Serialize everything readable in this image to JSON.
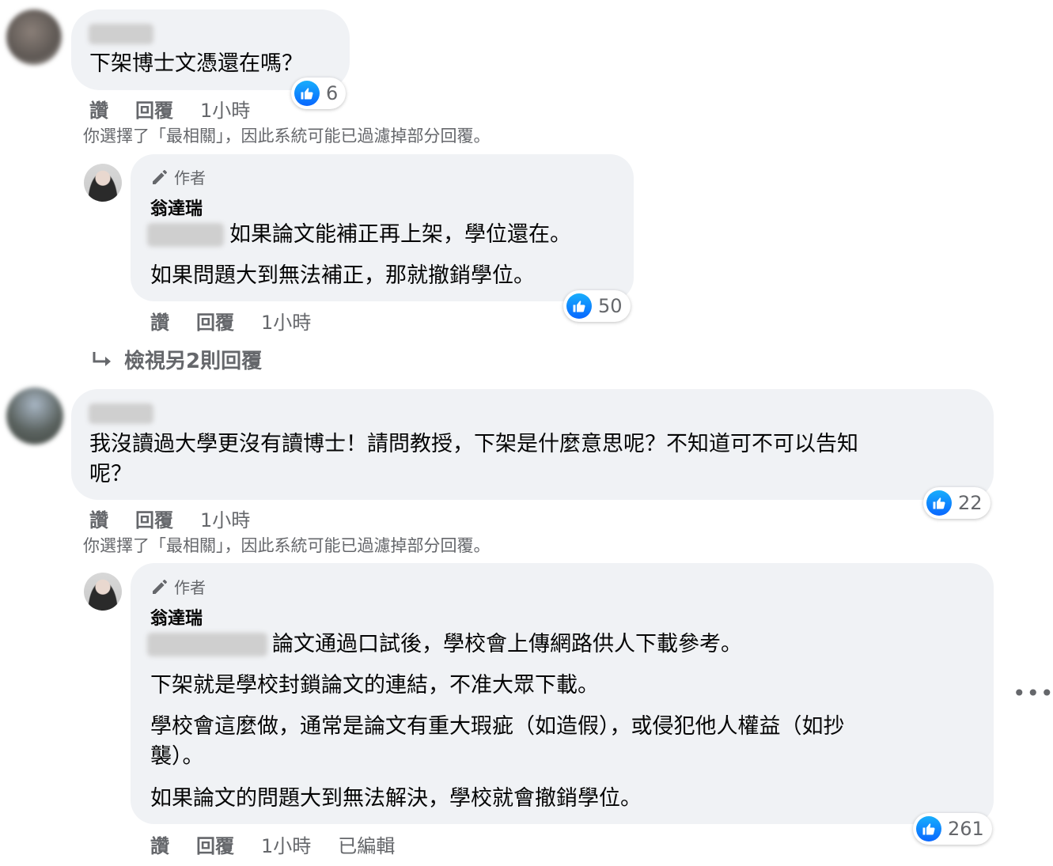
{
  "comments": [
    {
      "text": "下架博士文憑還在嗎？",
      "likes": "6",
      "actions": {
        "like": "讚",
        "reply": "回覆",
        "time": "1小時"
      },
      "filter_note": "你選擇了「最相關」，因此系統可能已過濾掉部分回覆。",
      "reply": {
        "author_badge": "作者",
        "author_name": "翁達瑞",
        "lines": [
          "如果論文能補正再上架，學位還在。",
          "如果問題大到無法補正，那就撤銷學位。"
        ],
        "likes": "50",
        "actions": {
          "like": "讚",
          "reply": "回覆",
          "time": "1小時"
        }
      },
      "view_more": "檢視另2則回覆"
    },
    {
      "text_lines": [
        "我沒讀過大學更沒有讀博士！請問教授，下架是什麼意思呢？不知道可不可以告知",
        "呢？"
      ],
      "likes": "22",
      "actions": {
        "like": "讚",
        "reply": "回覆",
        "time": "1小時"
      },
      "filter_note": "你選擇了「最相關」，因此系統可能已過濾掉部分回覆。",
      "reply": {
        "author_badge": "作者",
        "author_name": "翁達瑞",
        "lines": [
          "論文通過口試後，學校會上傳網路供人下載參考。",
          "下架就是學校封鎖論文的連結，不准大眾下載。",
          "學校會這麼做，通常是論文有重大瑕疵（如造假），或侵犯他人權益（如抄",
          "襲）。",
          "如果論文的問題大到無法解決，學校就會撤銷學位。"
        ],
        "likes": "261",
        "actions": {
          "like": "讚",
          "reply": "回覆",
          "time": "1小時",
          "edited": "已編輯"
        }
      }
    }
  ],
  "icons": {
    "like": "thumbs-up-icon",
    "author": "pencil-icon",
    "reply_arrow": "reply-arrow-icon",
    "more": "more-options-icon"
  },
  "colors": {
    "bubble": "#f0f2f5",
    "like_blue": "#0866ff",
    "meta_gray": "#65676b"
  }
}
